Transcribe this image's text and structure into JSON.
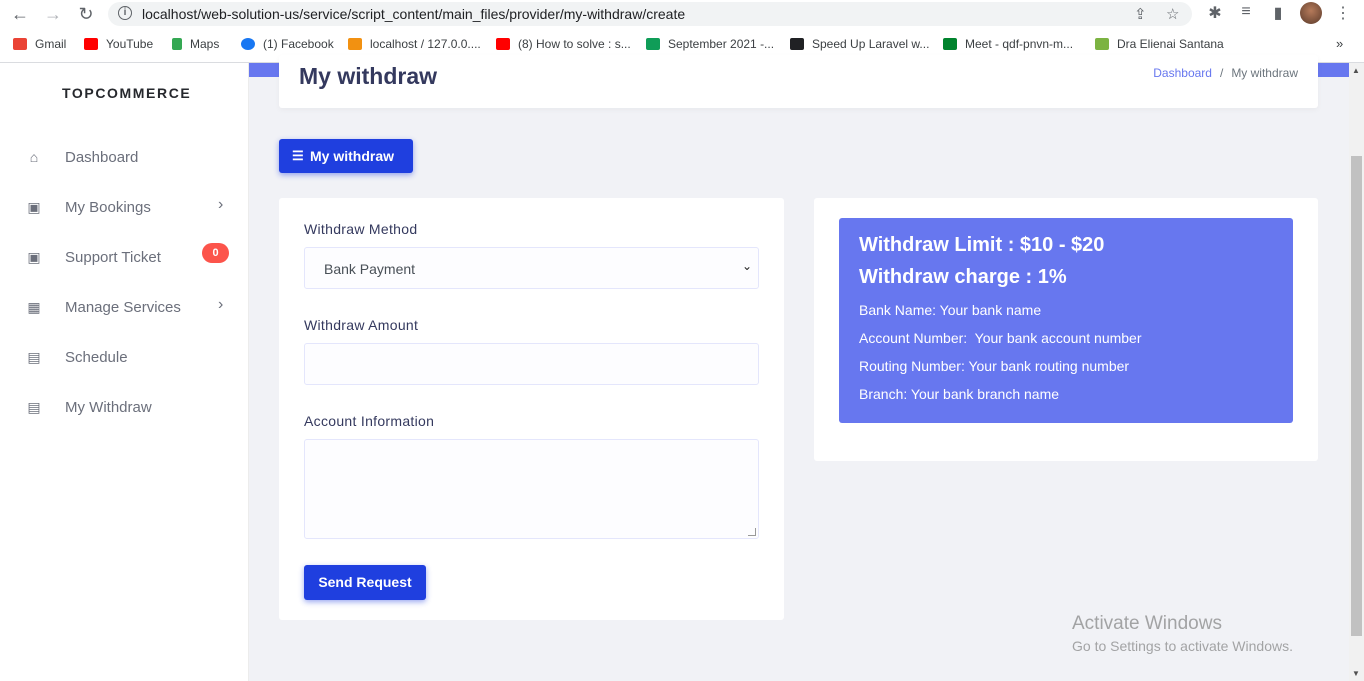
{
  "browser": {
    "url": "localhost/web-solution-us/service/script_content/main_files/provider/my-withdraw/create",
    "bookmarks": [
      {
        "label": "Gmail",
        "color": "#ea4335"
      },
      {
        "label": "YouTube",
        "color": "#ff0000"
      },
      {
        "label": "Maps",
        "color": "#34a853"
      },
      {
        "label": "(1) Facebook",
        "color": "#1877f2"
      },
      {
        "label": "localhost / 127.0.0....",
        "color": "#f29111"
      },
      {
        "label": "(8) How to solve : s...",
        "color": "#ff0000"
      },
      {
        "label": "September 2021 -...",
        "color": "#0f9d58"
      },
      {
        "label": "Speed Up Laravel w...",
        "color": "#202124"
      },
      {
        "label": "Meet - qdf-pnvn-m...",
        "color": "#00832d"
      },
      {
        "label": "Dra Elienai Santana",
        "color": "#7cb342"
      }
    ],
    "more": "»"
  },
  "sidebar": {
    "brand": "TOPCOMMERCE",
    "items": [
      {
        "label": "Dashboard",
        "icon": "home-icon",
        "glyph": "⌂"
      },
      {
        "label": "My Bookings",
        "icon": "cart-icon",
        "glyph": "🛒",
        "chevron": "›"
      },
      {
        "label": "Support Ticket",
        "icon": "ticket-icon",
        "glyph": "▣",
        "badge": "0"
      },
      {
        "label": "Manage Services",
        "icon": "grid-icon",
        "glyph": "▦",
        "chevron": "›"
      },
      {
        "label": "Schedule",
        "icon": "schedule-icon",
        "glyph": "▤"
      },
      {
        "label": "My Withdraw",
        "icon": "withdraw-icon",
        "glyph": "▤"
      }
    ]
  },
  "header": {
    "title": "My withdraw",
    "breadcrumb": {
      "home": "Dashboard",
      "separator": "/",
      "current": "My withdraw"
    }
  },
  "list_button": {
    "label": "My withdraw",
    "icon": "list-icon"
  },
  "form": {
    "method_label": "Withdraw Method",
    "method_value": "Bank Payment",
    "amount_label": "Withdraw Amount",
    "amount_value": "",
    "account_label": "Account Information",
    "account_value": "",
    "submit_label": "Send Request"
  },
  "info": {
    "limit": "Withdraw Limit : $10 - $20",
    "charge": "Withdraw charge : 1%",
    "lines": [
      "Bank Name: Your bank name",
      "Account Number:  Your bank account number",
      "Routing Number: Your bank routing number",
      "Branch: Your bank branch name"
    ]
  },
  "watermark": {
    "title": "Activate Windows",
    "subtitle": "Go to Settings to activate Windows."
  },
  "colors": {
    "primary": "#6777ef",
    "button": "#1f3fdf",
    "badge": "#fc544b"
  }
}
